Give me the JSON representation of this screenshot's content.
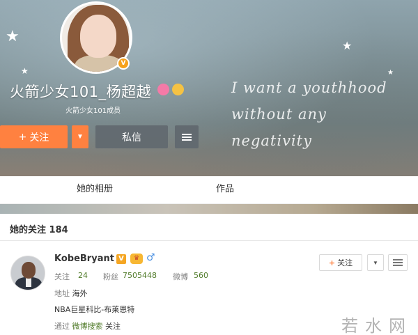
{
  "profile": {
    "name": "火箭少女101_杨超越",
    "caption": "火箭少女101成员",
    "verified_badge": "V",
    "slogan": [
      "I want a youthhood",
      "without any",
      "negativity"
    ],
    "buttons": {
      "follow": "关注",
      "follow_plus": "+",
      "message": "私信"
    },
    "icons": [
      "verified-badge-icon",
      "flower-icon",
      "emoji-face-icon"
    ]
  },
  "tabs": [
    "她的相册",
    "作品"
  ],
  "following": {
    "title": "她的关注 184",
    "users": [
      {
        "name": "KobeBryant",
        "badge": "V",
        "gender_icon": "♂",
        "following_label": "关注",
        "following_count": "24",
        "fans_label": "粉丝",
        "fans_count": "7505448",
        "weibo_label": "微博",
        "weibo_count": "560",
        "location_label": "地址",
        "location": "海外",
        "bio": "NBA巨星科比-布莱恩特",
        "via_prefix": "通过",
        "via_link": "微博搜索",
        "via_suffix": "关注",
        "follow_button": "关注",
        "follow_plus": "+"
      }
    ]
  },
  "watermark": "若水网",
  "colors": {
    "accent_orange": "#ff8140",
    "stat_green": "#4f7a28",
    "button_gray": "#626a70"
  }
}
